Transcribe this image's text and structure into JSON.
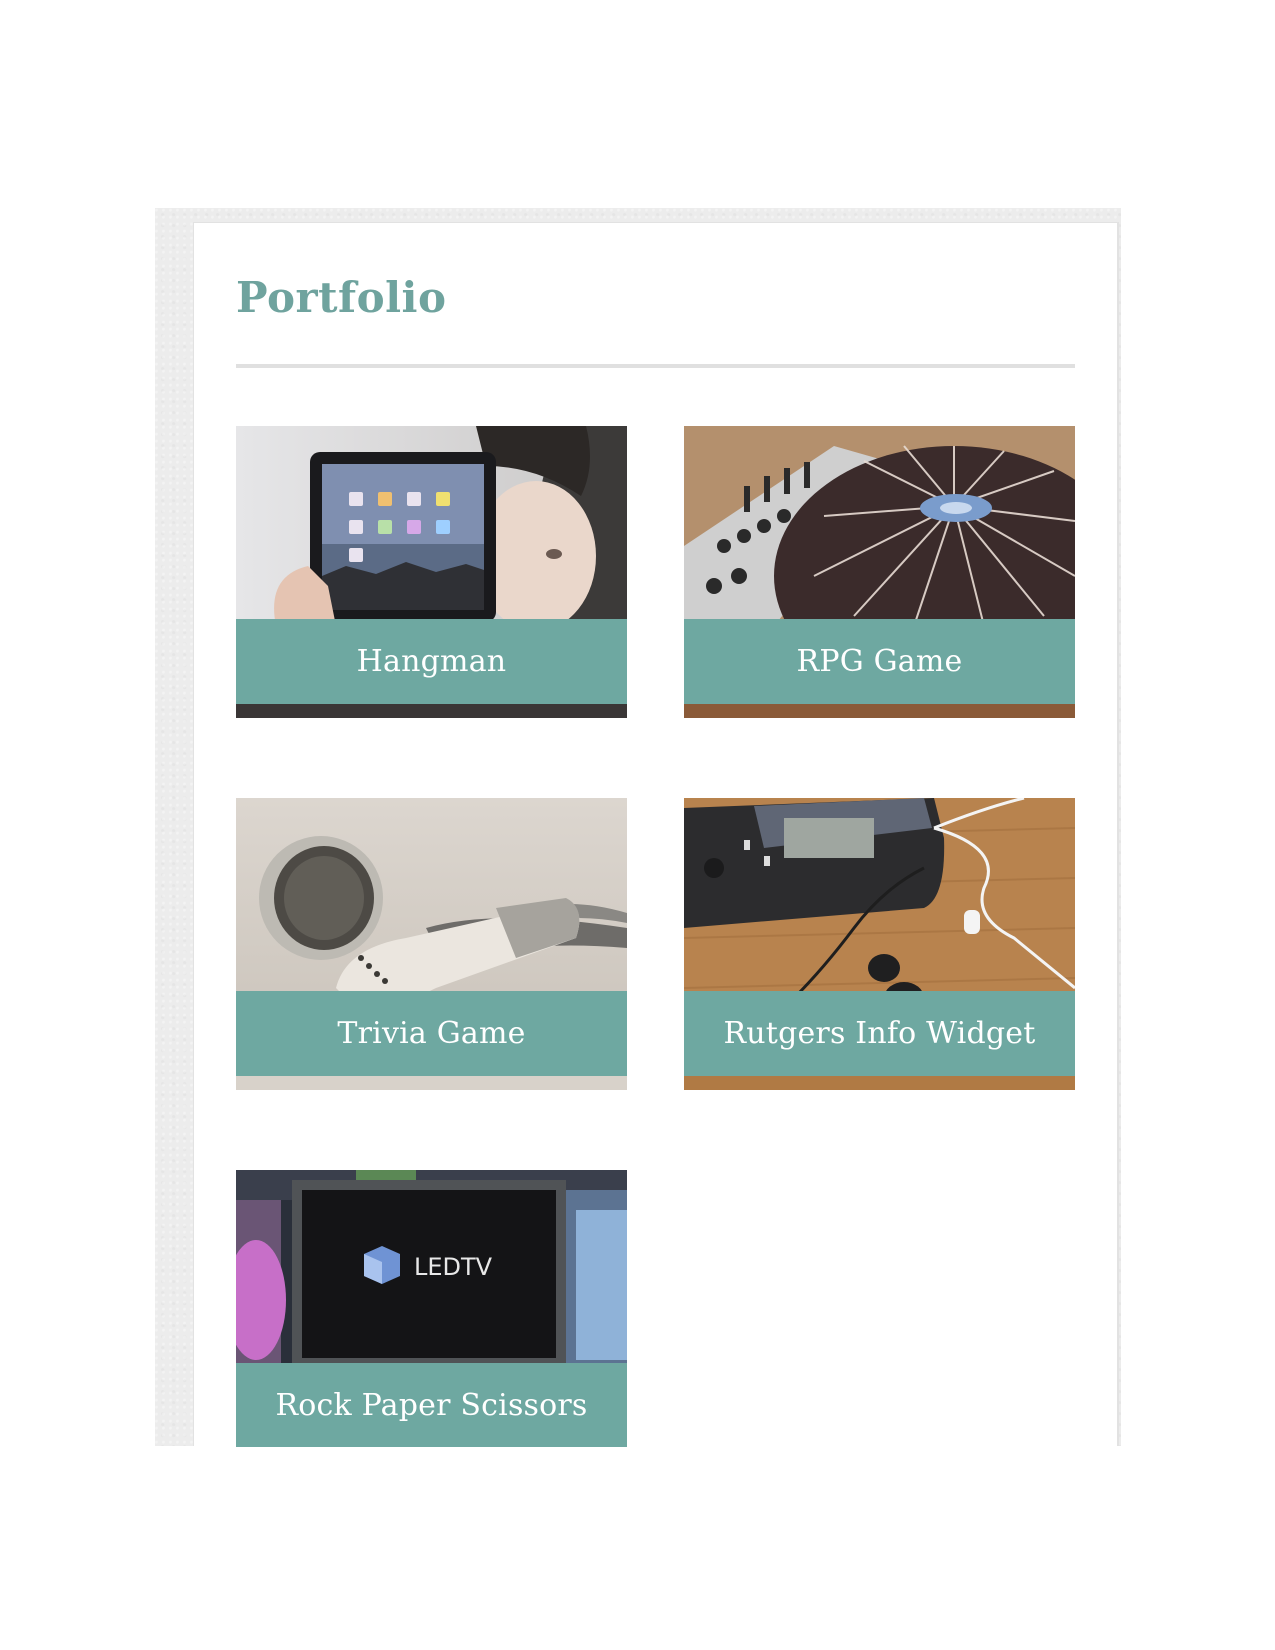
{
  "page": {
    "title": "Portfolio"
  },
  "portfolio": {
    "items": [
      {
        "label": "Hangman",
        "image": "tablet-held-by-person"
      },
      {
        "label": "RPG Game",
        "image": "dj-turntable-mixer"
      },
      {
        "label": "Trivia Game",
        "image": "white-earbuds"
      },
      {
        "label": "Rutgers Info Widget",
        "image": "smartphone-with-earphones"
      },
      {
        "label": "Rock Paper Scissors",
        "image": "led-tv-display"
      }
    ]
  },
  "screen_text": {
    "led_tv_logo": "LEDTV"
  },
  "colors": {
    "accent": "#6fa39e",
    "caption_bg": "#6ea8a1",
    "caption_text": "#ffffff",
    "divider": "#e0e0e0",
    "backdrop": "#ececec"
  }
}
